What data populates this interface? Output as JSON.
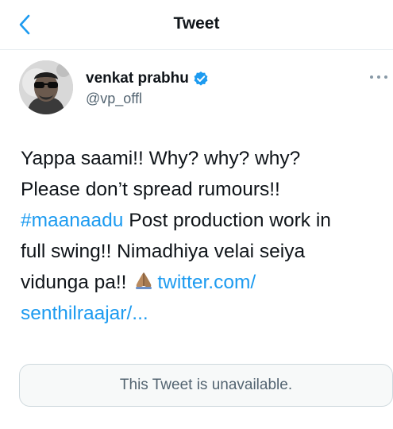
{
  "header": {
    "title": "Tweet",
    "back_icon": "chevron-left-icon"
  },
  "tweet": {
    "author_name": "venkat prabhu",
    "author_handle": "@vp_offl",
    "verified_icon": "verified-badge-icon",
    "more_icon": "more-horizontal-icon",
    "text": {
      "line1": "Yappa saami!! Why? why? why?",
      "line2": "Please don’t spread rumours!!",
      "hashtag": "#maanaadu",
      "line3_rest": " Post production work in",
      "line4": "full swing!! Nimadhiya velai seiya",
      "line5_start": "vidunga pa!!",
      "emoji_icon": "folded-hands-icon",
      "link_part1": "twitter.com/",
      "link_part2": "senthilraajar/..."
    },
    "quoted_unavailable": "This Tweet is unavailable."
  },
  "colors": {
    "link": "#1d9bf0",
    "text": "#0f1419",
    "secondary": "#536471"
  }
}
